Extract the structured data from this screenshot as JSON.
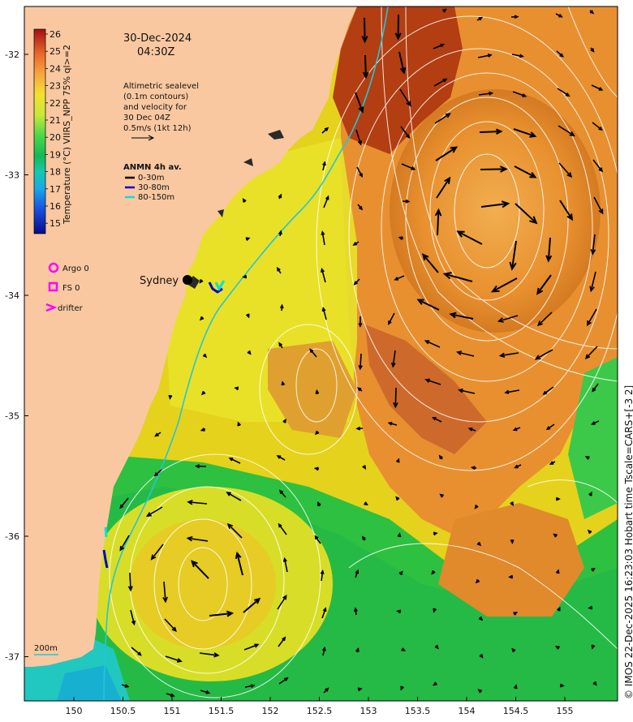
{
  "map": {
    "date": "30-Dec-2024",
    "time": "04:30Z",
    "altimetry_note": [
      "Altimetric sealevel",
      "(0.1m contours)",
      "and velocity for",
      "30 Dec 04Z",
      "0.5m/s (1kt 12h)"
    ],
    "anmn_title": "ANMN 4h av.",
    "anmn_ranges": [
      "0-30m",
      "30-80m",
      "80-150m"
    ],
    "argo_label": "Argo 0",
    "fs_label": "FS 0",
    "drifter_label": "drifter",
    "city_label": "Sydney",
    "isobath_label": "200m",
    "colorbar_label": "Temperature (°C) VIIRS_NPP 75% ql>=2",
    "colorbar_ticks": [
      "26",
      "25",
      "24",
      "23",
      "22",
      "21",
      "20",
      "19",
      "18",
      "17",
      "16",
      "15"
    ],
    "lat_ticks": [
      "-32",
      "-33",
      "-34",
      "-35",
      "-36",
      "-37"
    ],
    "lon_ticks": [
      "150",
      "150.5",
      "151",
      "151.5",
      "152",
      "152.5",
      "153",
      "153.5",
      "154",
      "154.5",
      "155"
    ],
    "credit": "© IMOS 22-Dec-2025 16:23:03 Hobart time Tscale=CARS+[-3 2]",
    "colors": {
      "land": "#f9c8a0",
      "argo": "#ff00ff",
      "anmn_0_30": "#000000",
      "anmn_30_80": "#0000cc",
      "anmn_80_150": "#00e0e0",
      "isobath": "#22c6d8"
    }
  }
}
